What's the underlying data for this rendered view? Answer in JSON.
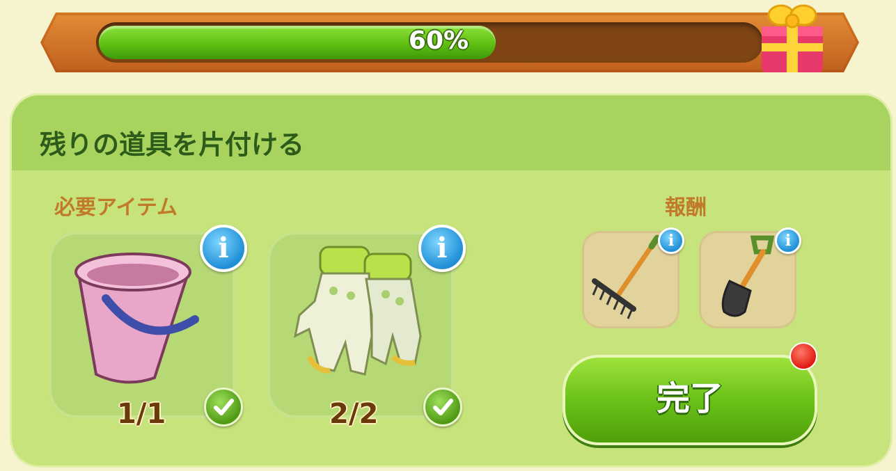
{
  "progress": {
    "value_percent": 60,
    "label": "60%"
  },
  "gift_icon": "gift-box-icon",
  "task": {
    "title": "残りの道具を片付ける"
  },
  "required": {
    "label": "必要アイテム",
    "items": [
      {
        "name": "bucket",
        "icon": "bucket-icon",
        "count": "1/1",
        "complete": true
      },
      {
        "name": "gloves",
        "icon": "gloves-icon",
        "count": "2/2",
        "complete": true
      }
    ]
  },
  "rewards": {
    "label": "報酬",
    "items": [
      {
        "name": "rake",
        "icon": "rake-icon"
      },
      {
        "name": "shovel",
        "icon": "shovel-icon"
      }
    ]
  },
  "complete_button": {
    "label": "完了"
  },
  "colors": {
    "accent": "#6bc118",
    "banner": "#c2621f",
    "panel": "#c7e37c"
  }
}
